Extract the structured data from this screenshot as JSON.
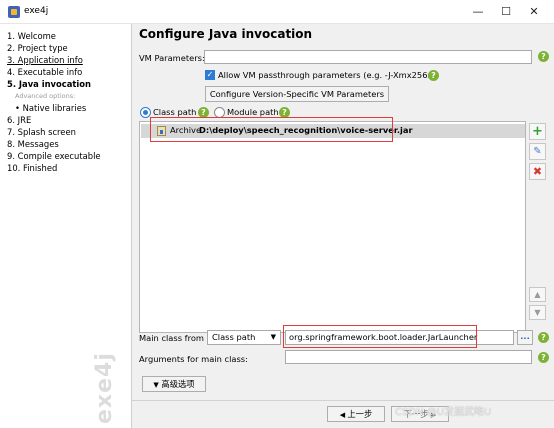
{
  "window": {
    "title": "exe4j"
  },
  "titlebar_buttons": {
    "minimize": "—",
    "maximize": "☐",
    "close": "✕"
  },
  "sidebar": {
    "items": [
      {
        "label": "1. Welcome",
        "style": "normal"
      },
      {
        "label": "2. Project type",
        "style": "normal"
      },
      {
        "label": "3. Application info",
        "style": "link"
      },
      {
        "label": "4. Executable info",
        "style": "normal"
      },
      {
        "label": "5. Java invocation",
        "style": "active"
      },
      {
        "label": "Advanced options:",
        "style": "sub-label"
      },
      {
        "label": "•  Native libraries",
        "style": "sub"
      },
      {
        "label": "6. JRE",
        "style": "normal"
      },
      {
        "label": "7. Splash screen",
        "style": "normal"
      },
      {
        "label": "8. Messages",
        "style": "normal"
      },
      {
        "label": "9. Compile executable",
        "style": "normal"
      },
      {
        "label": "10. Finished",
        "style": "normal"
      }
    ],
    "watermark": "exe4j"
  },
  "main": {
    "heading": "Configure Java invocation",
    "vm_parameters_label": "VM Parameters:",
    "vm_parameters_value": "",
    "passthrough_label": "Allow VM passthrough parameters (e.g. -J-Xmx256m)",
    "passthrough_checked": true,
    "version_specific_button": "Configure Version-Specific VM Parameters",
    "classpath_radio": "Class path",
    "modulepath_radio": "Module path",
    "selected_path_mode": "Class path",
    "classpath_entries": [
      {
        "kind": "Archive",
        "path": "D:\\deploy\\speech_recognition\\voice-server.jar"
      }
    ],
    "list_tools": {
      "add": "+",
      "edit": "✎",
      "remove": "✖",
      "up": "▲",
      "down": "▼"
    },
    "main_class_label": "Main class from",
    "main_class_source": "Class path",
    "main_class_value": "org.springframework.boot.loader.JarLauncher",
    "browse_button": "...",
    "arguments_label": "Arguments for main class:",
    "arguments_value": "",
    "advanced_button": "高级选项",
    "advanced_caret": "▼",
    "back_button": "上一步",
    "next_button": "下一步",
    "help_glyph": "?",
    "check_glyph": "✓"
  },
  "overlay_watermark": "CSDN @U发掘武略U",
  "colors": {
    "accent": "#2d7bd5",
    "help_green": "#7db234",
    "highlight_red": "#e23b3b",
    "selection_gray": "#d7d7d7"
  }
}
